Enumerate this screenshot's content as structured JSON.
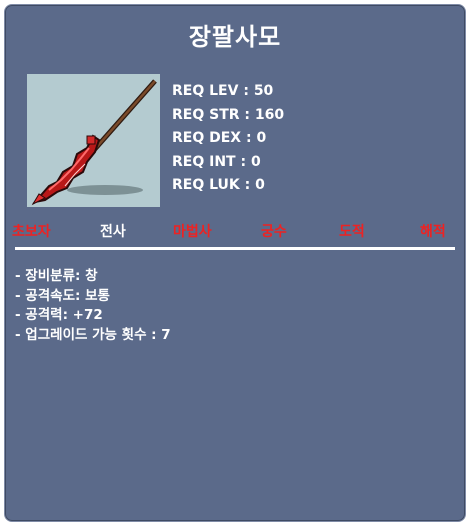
{
  "item": {
    "name": "장팔사모",
    "icon": "spear-icon"
  },
  "requirements": [
    {
      "label": "REQ LEV",
      "value": "50"
    },
    {
      "label": "REQ STR",
      "value": "160"
    },
    {
      "label": "REQ DEX",
      "value": "0"
    },
    {
      "label": "REQ INT",
      "value": "0"
    },
    {
      "label": "REQ LUK",
      "value": "0"
    }
  ],
  "classes": [
    {
      "name": "초보자",
      "color": "#ee2222"
    },
    {
      "name": "전사",
      "color": "#ffffff"
    },
    {
      "name": "마법사",
      "color": "#ee2222"
    },
    {
      "name": "궁수",
      "color": "#ee2222"
    },
    {
      "name": "도적",
      "color": "#ee2222"
    },
    {
      "name": "해적",
      "color": "#ee2222"
    }
  ],
  "details": [
    "- 장비분류: 창",
    "- 공격속도: 보통",
    "- 공격력: +72",
    "- 업그레이드 가능 횟수 : 7"
  ],
  "colors": {
    "panel": "#5b6a8a",
    "icon_background": "#b4cbd0",
    "restricted_class": "#ee2222",
    "allowed_class": "#ffffff"
  }
}
